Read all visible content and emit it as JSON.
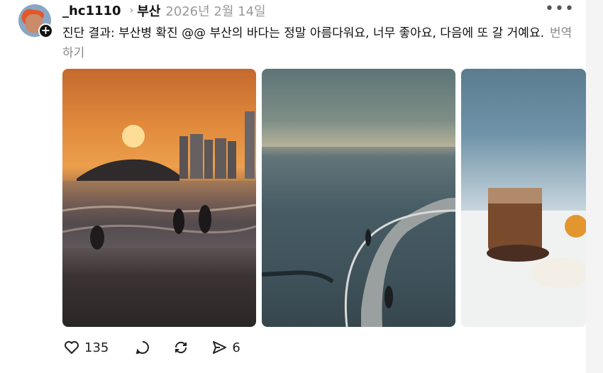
{
  "post": {
    "username": "_hc1110",
    "location": "부산",
    "date": "2026년 2월 14일",
    "text": "진단 결과: 부산병 확진 @@ 부산의 바다는 정말 아름다워요, 너무 좋아요, 다음에 또 갈 거예요.",
    "translate_label": "번역하기"
  },
  "media": [
    {
      "kind": "video",
      "description_icon": "mute-icon"
    },
    {
      "kind": "image"
    },
    {
      "kind": "image"
    }
  ],
  "actions": {
    "like_count": "135",
    "repost_count": "",
    "comment_count": "",
    "share_count": "6"
  },
  "colors": {
    "text": "#101010",
    "muted": "#9a9a9a"
  }
}
